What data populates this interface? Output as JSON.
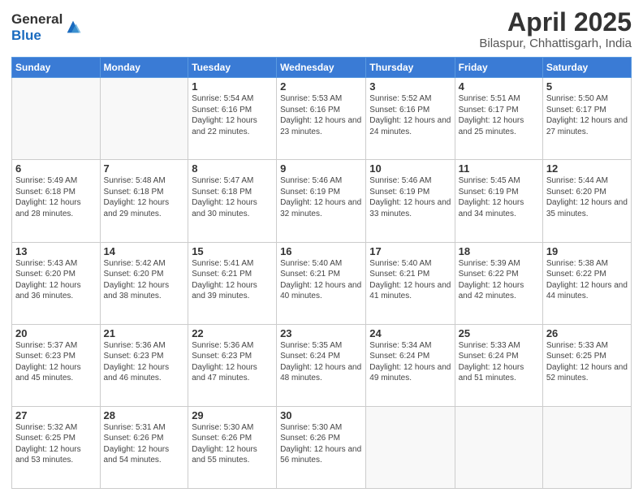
{
  "logo": {
    "general": "General",
    "blue": "Blue"
  },
  "header": {
    "title": "April 2025",
    "subtitle": "Bilaspur, Chhattisgarh, India"
  },
  "weekdays": [
    "Sunday",
    "Monday",
    "Tuesday",
    "Wednesday",
    "Thursday",
    "Friday",
    "Saturday"
  ],
  "weeks": [
    [
      {
        "day": "",
        "info": ""
      },
      {
        "day": "",
        "info": ""
      },
      {
        "day": "1",
        "info": "Sunrise: 5:54 AM\nSunset: 6:16 PM\nDaylight: 12 hours and 22 minutes."
      },
      {
        "day": "2",
        "info": "Sunrise: 5:53 AM\nSunset: 6:16 PM\nDaylight: 12 hours and 23 minutes."
      },
      {
        "day": "3",
        "info": "Sunrise: 5:52 AM\nSunset: 6:16 PM\nDaylight: 12 hours and 24 minutes."
      },
      {
        "day": "4",
        "info": "Sunrise: 5:51 AM\nSunset: 6:17 PM\nDaylight: 12 hours and 25 minutes."
      },
      {
        "day": "5",
        "info": "Sunrise: 5:50 AM\nSunset: 6:17 PM\nDaylight: 12 hours and 27 minutes."
      }
    ],
    [
      {
        "day": "6",
        "info": "Sunrise: 5:49 AM\nSunset: 6:18 PM\nDaylight: 12 hours and 28 minutes."
      },
      {
        "day": "7",
        "info": "Sunrise: 5:48 AM\nSunset: 6:18 PM\nDaylight: 12 hours and 29 minutes."
      },
      {
        "day": "8",
        "info": "Sunrise: 5:47 AM\nSunset: 6:18 PM\nDaylight: 12 hours and 30 minutes."
      },
      {
        "day": "9",
        "info": "Sunrise: 5:46 AM\nSunset: 6:19 PM\nDaylight: 12 hours and 32 minutes."
      },
      {
        "day": "10",
        "info": "Sunrise: 5:46 AM\nSunset: 6:19 PM\nDaylight: 12 hours and 33 minutes."
      },
      {
        "day": "11",
        "info": "Sunrise: 5:45 AM\nSunset: 6:19 PM\nDaylight: 12 hours and 34 minutes."
      },
      {
        "day": "12",
        "info": "Sunrise: 5:44 AM\nSunset: 6:20 PM\nDaylight: 12 hours and 35 minutes."
      }
    ],
    [
      {
        "day": "13",
        "info": "Sunrise: 5:43 AM\nSunset: 6:20 PM\nDaylight: 12 hours and 36 minutes."
      },
      {
        "day": "14",
        "info": "Sunrise: 5:42 AM\nSunset: 6:20 PM\nDaylight: 12 hours and 38 minutes."
      },
      {
        "day": "15",
        "info": "Sunrise: 5:41 AM\nSunset: 6:21 PM\nDaylight: 12 hours and 39 minutes."
      },
      {
        "day": "16",
        "info": "Sunrise: 5:40 AM\nSunset: 6:21 PM\nDaylight: 12 hours and 40 minutes."
      },
      {
        "day": "17",
        "info": "Sunrise: 5:40 AM\nSunset: 6:21 PM\nDaylight: 12 hours and 41 minutes."
      },
      {
        "day": "18",
        "info": "Sunrise: 5:39 AM\nSunset: 6:22 PM\nDaylight: 12 hours and 42 minutes."
      },
      {
        "day": "19",
        "info": "Sunrise: 5:38 AM\nSunset: 6:22 PM\nDaylight: 12 hours and 44 minutes."
      }
    ],
    [
      {
        "day": "20",
        "info": "Sunrise: 5:37 AM\nSunset: 6:23 PM\nDaylight: 12 hours and 45 minutes."
      },
      {
        "day": "21",
        "info": "Sunrise: 5:36 AM\nSunset: 6:23 PM\nDaylight: 12 hours and 46 minutes."
      },
      {
        "day": "22",
        "info": "Sunrise: 5:36 AM\nSunset: 6:23 PM\nDaylight: 12 hours and 47 minutes."
      },
      {
        "day": "23",
        "info": "Sunrise: 5:35 AM\nSunset: 6:24 PM\nDaylight: 12 hours and 48 minutes."
      },
      {
        "day": "24",
        "info": "Sunrise: 5:34 AM\nSunset: 6:24 PM\nDaylight: 12 hours and 49 minutes."
      },
      {
        "day": "25",
        "info": "Sunrise: 5:33 AM\nSunset: 6:24 PM\nDaylight: 12 hours and 51 minutes."
      },
      {
        "day": "26",
        "info": "Sunrise: 5:33 AM\nSunset: 6:25 PM\nDaylight: 12 hours and 52 minutes."
      }
    ],
    [
      {
        "day": "27",
        "info": "Sunrise: 5:32 AM\nSunset: 6:25 PM\nDaylight: 12 hours and 53 minutes."
      },
      {
        "day": "28",
        "info": "Sunrise: 5:31 AM\nSunset: 6:26 PM\nDaylight: 12 hours and 54 minutes."
      },
      {
        "day": "29",
        "info": "Sunrise: 5:30 AM\nSunset: 6:26 PM\nDaylight: 12 hours and 55 minutes."
      },
      {
        "day": "30",
        "info": "Sunrise: 5:30 AM\nSunset: 6:26 PM\nDaylight: 12 hours and 56 minutes."
      },
      {
        "day": "",
        "info": ""
      },
      {
        "day": "",
        "info": ""
      },
      {
        "day": "",
        "info": ""
      }
    ]
  ]
}
